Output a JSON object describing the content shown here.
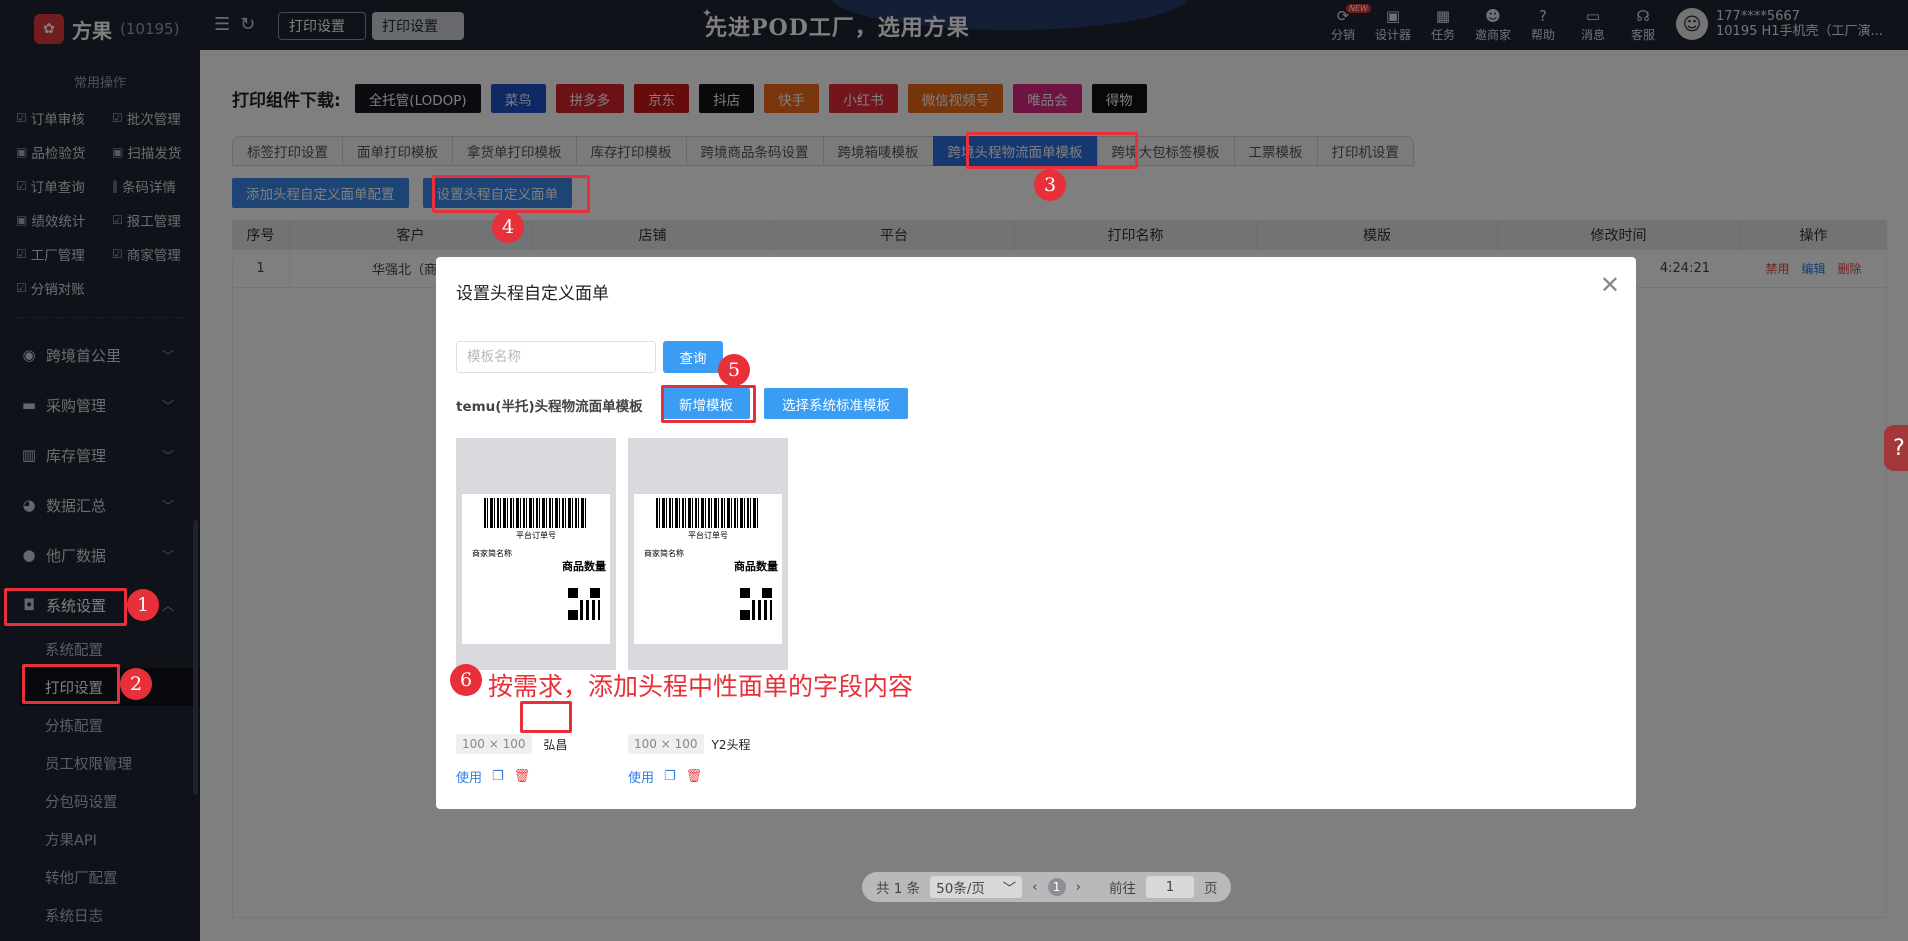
{
  "app": {
    "logo_text": "方果",
    "logo_id": "(10195)"
  },
  "sidebar": {
    "common_title": "常用操作",
    "quick": [
      "订单审核",
      "批次管理",
      "品检验货",
      "扫描发货",
      "订单查询",
      "条码详情",
      "绩效统计",
      "报工管理",
      "工厂管理",
      "商家管理",
      "分销对账"
    ],
    "groups": [
      "跨境首公里",
      "采购管理",
      "库存管理",
      "数据汇总",
      "他厂数据"
    ],
    "active_group": "系统设置",
    "sub_items": [
      "系统配置",
      "打印设置",
      "分拣配置",
      "员工权限管理",
      "分包码设置",
      "方果API",
      "转他厂配置",
      "系统日志"
    ]
  },
  "topbar": {
    "tab1": "打印设置",
    "tab2": "打印设置",
    "slogan": "先进POD工厂，选用方果",
    "nav": [
      "分销",
      "设计器",
      "任务",
      "邀商家",
      "帮助",
      "消息",
      "客服"
    ],
    "new_badge": "NEW",
    "user_line1": "177****5667",
    "user_line2": "10195 H1手机壳（工厂演..."
  },
  "download": {
    "title": "打印组件下载:",
    "buttons": [
      {
        "label": "全托管(LODOP)",
        "color": "#1a1420"
      },
      {
        "label": "菜鸟",
        "color": "#1f52c9"
      },
      {
        "label": "拼多多",
        "color": "#d8242f"
      },
      {
        "label": "京东",
        "color": "#cc1818"
      },
      {
        "label": "抖店",
        "color": "#121216"
      },
      {
        "label": "快手",
        "color": "#f26a17"
      },
      {
        "label": "小红书",
        "color": "#e62b39"
      },
      {
        "label": "微信视频号",
        "color": "#ef6b16"
      },
      {
        "label": "唯品会",
        "color": "#df2985"
      },
      {
        "label": "得物",
        "color": "#111111"
      }
    ]
  },
  "tabs": [
    "标签打印设置",
    "面单打印模板",
    "拿货单打印模板",
    "库存打印模板",
    "跨境商品条码设置",
    "跨境箱唛模板",
    "跨境头程物流面单模板",
    "跨境大包标签模板",
    "工票模板",
    "打印机设置"
  ],
  "active_tab_index": 6,
  "actions": {
    "add": "添加头程自定义面单配置",
    "set": "设置头程自定义面单"
  },
  "table": {
    "headers": [
      "序号",
      "客户",
      "店铺",
      "平台",
      "打印名称",
      "模版",
      "修改时间",
      "操作"
    ],
    "row": {
      "index": "1",
      "customer": "华强北（商家",
      "time": "4:24:21",
      "ops": [
        "禁用",
        "编辑",
        "删除"
      ]
    }
  },
  "pagination": {
    "total": "共 1 条",
    "page_size": "50条/页",
    "current": "1",
    "goto_label": "前往",
    "goto_value": "1",
    "page_unit": "页"
  },
  "modal": {
    "title": "设置头程自定义面单",
    "search_placeholder": "模板名称",
    "query": "查询",
    "tpl_label": "temu(半托)头程物流面单模板",
    "new_template": "新增模板",
    "system_template": "选择系统标准模板",
    "cards": [
      {
        "size": "100 × 100",
        "name": "弘昌",
        "use": "使用"
      },
      {
        "size": "100 × 100",
        "name": "Y2头程",
        "use": "使用"
      }
    ],
    "label_preview": {
      "barcode_text": "平台订单号",
      "shop_name": "商家简名称",
      "qty": "商品数量"
    }
  },
  "annotations": {
    "badges": [
      "1",
      "2",
      "3",
      "4",
      "5",
      "6"
    ],
    "note": "按需求，添加头程中性面单的字段内容"
  }
}
